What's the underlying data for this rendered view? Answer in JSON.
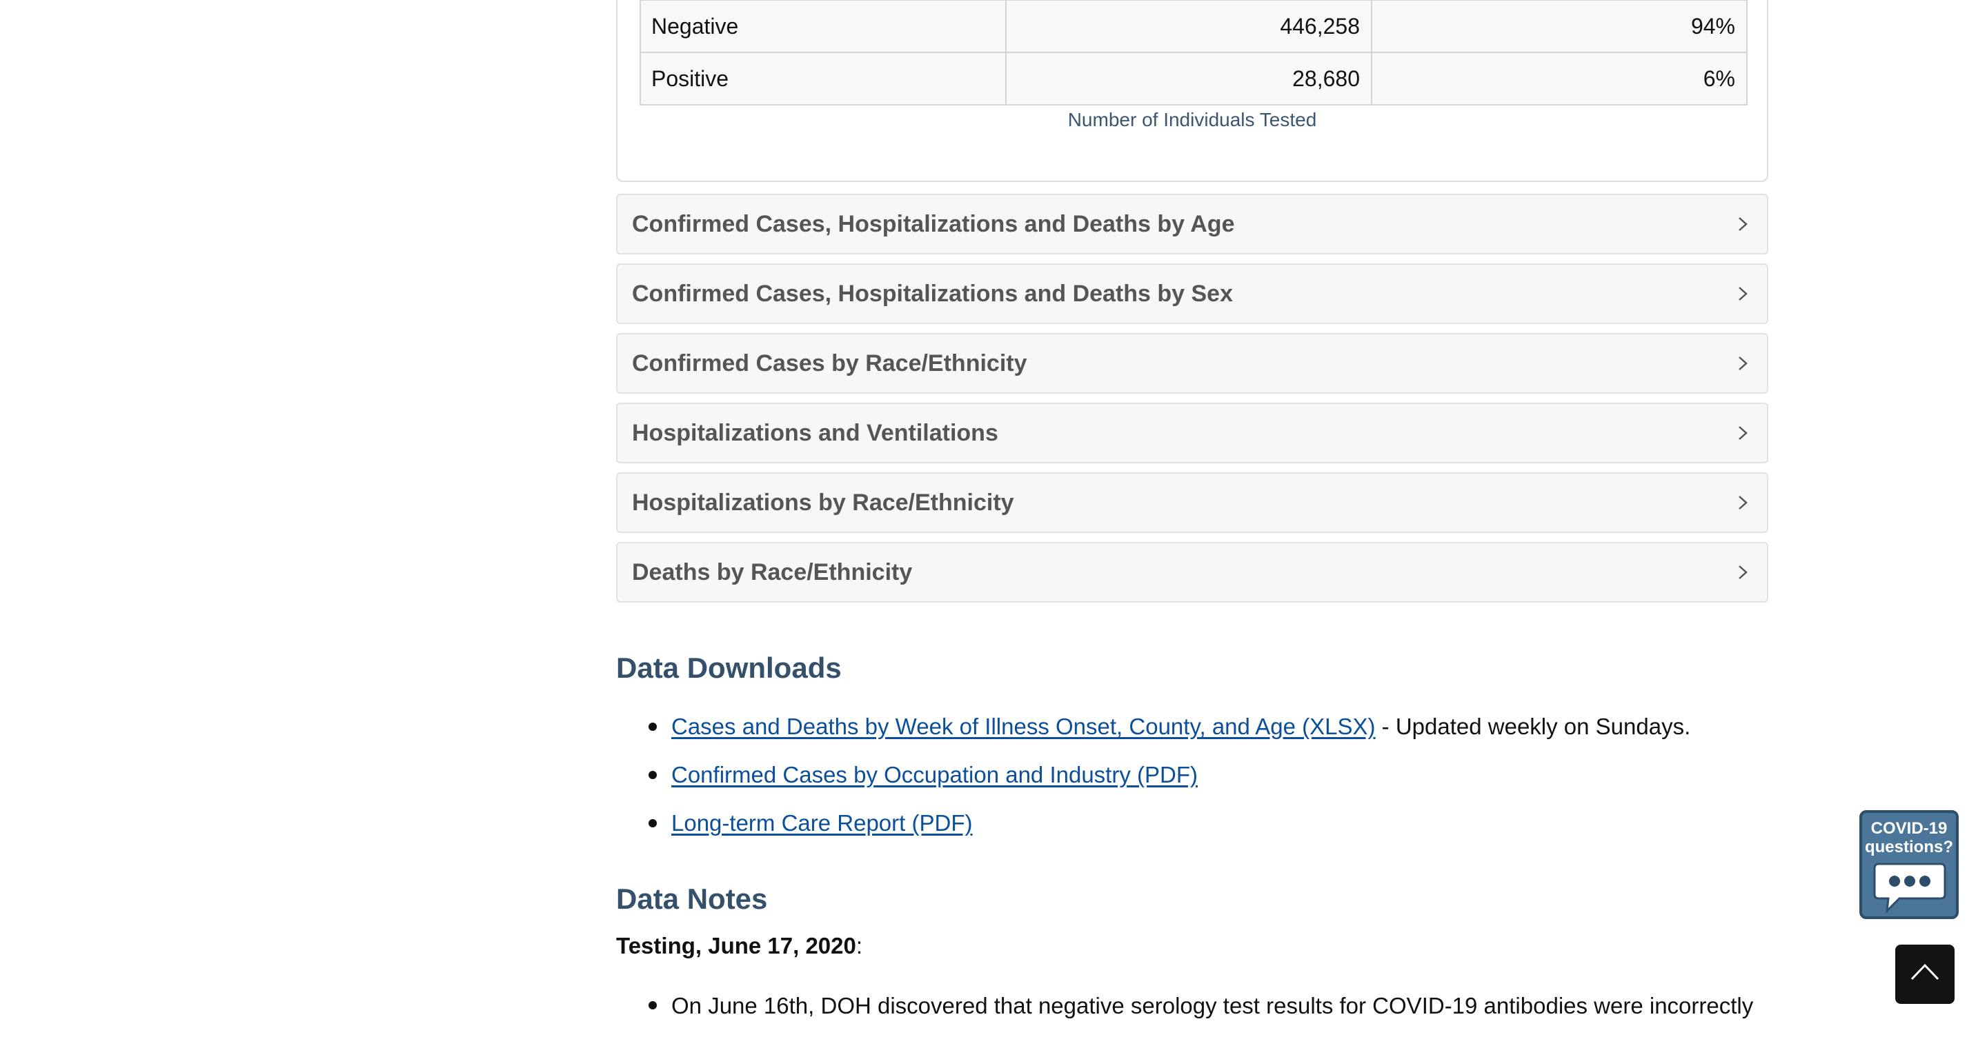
{
  "testing_table": {
    "rows": [
      {
        "label": "Negative",
        "count": "446,258",
        "percent": "94%"
      },
      {
        "label": "Positive",
        "count": "28,680",
        "percent": "6%"
      }
    ],
    "caption": "Number of Individuals Tested"
  },
  "accordions": [
    {
      "title": "Confirmed Cases, Hospitalizations and Deaths by Age",
      "icon": "chevron-right-icon"
    },
    {
      "title": "Confirmed Cases, Hospitalizations and Deaths by Sex",
      "icon": "chevron-right-icon"
    },
    {
      "title": "Confirmed Cases by Race/Ethnicity",
      "icon": "chevron-right-icon"
    },
    {
      "title": "Hospitalizations and Ventilations",
      "icon": "chevron-right-icon"
    },
    {
      "title": "Hospitalizations by Race/Ethnicity",
      "icon": "chevron-right-icon"
    },
    {
      "title": "Deaths by Race/Ethnicity",
      "icon": "chevron-right-icon"
    }
  ],
  "data_downloads": {
    "heading": "Data Downloads",
    "items": [
      {
        "link": "Cases and Deaths by Week of Illness Onset, County, and Age (XLSX)",
        "suffix": " - Updated weekly on Sundays."
      },
      {
        "link": "Confirmed Cases by Occupation and Industry (PDF)",
        "suffix": ""
      },
      {
        "link": "Long-term Care Report (PDF)",
        "suffix": ""
      }
    ]
  },
  "data_notes": {
    "heading": "Data Notes",
    "subheading": "Testing, June 17, 2020",
    "subheading_suffix": ":",
    "items": [
      "On June 16th, DOH discovered that negative serology test results for COVID-19 antibodies were incorrectly"
    ]
  },
  "widgets": {
    "covid_line1": "COVID-19",
    "covid_line2": "questions?",
    "covid_icon": "chat-bubble-icon",
    "back_to_top_icon": "chevron-up-icon"
  },
  "colors": {
    "heading": "#34506b",
    "link": "#0b4f9b",
    "accordion_bg": "#f7f7f7",
    "widget_bg": "#4c7699"
  }
}
